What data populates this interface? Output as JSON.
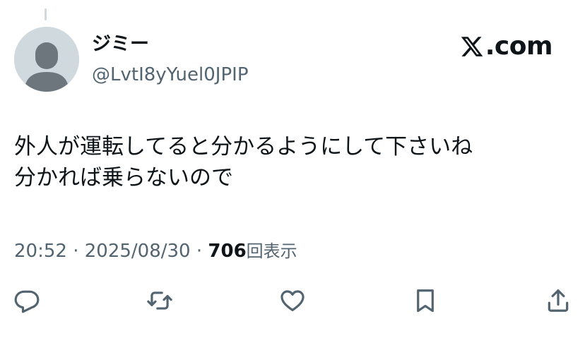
{
  "post": {
    "author": {
      "display_name": "ジミー",
      "handle": "@LvtI8yYuel0JPIP",
      "avatar_icon": "default-avatar-icon"
    },
    "brand": {
      "icon": "x-logo-icon",
      "suffix": ".com"
    },
    "text_lines": [
      "外人が運転してると分かるようにして下さいね",
      "分かれば乗らないので"
    ],
    "meta": {
      "time": "20:52",
      "separator": "·",
      "date": "2025/08/30",
      "views_count": "706",
      "views_label": "回表示"
    },
    "actions": [
      {
        "icon": "reply-icon"
      },
      {
        "icon": "repost-icon"
      },
      {
        "icon": "like-icon"
      },
      {
        "icon": "bookmark-icon"
      },
      {
        "icon": "share-icon"
      }
    ]
  },
  "colors": {
    "text_primary": "#0f1419",
    "text_secondary": "#536471",
    "avatar_background": "#cfd9de",
    "avatar_figure": "#6e767d"
  }
}
